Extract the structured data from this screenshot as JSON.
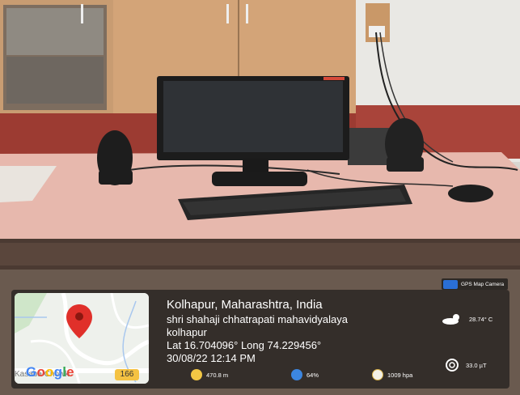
{
  "gps_badge_label": "GPS Map Camera",
  "map": {
    "logo_text": "Google",
    "faded_label": "Kasaba Chowk",
    "road_number": "166"
  },
  "location": {
    "line1": "Kolhapur, Maharashtra, India",
    "line2": "shri shahaji chhatrapati mahavidyalaya",
    "line3": "kolhapur",
    "coords": "Lat 16.704096° Long 74.229456°",
    "datetime": "30/08/22 12:14 PM"
  },
  "stats": {
    "temperature": "28.74° C",
    "magnetic": "33.0 µT",
    "altitude": "470.8 m",
    "humidity": "64%",
    "pressure": "1009 hpa"
  },
  "colors": {
    "map_pin": "#e0302a",
    "google_blue": "#4285F4",
    "google_red": "#EA4335",
    "google_yellow": "#FBBC05",
    "google_green": "#34A853"
  }
}
